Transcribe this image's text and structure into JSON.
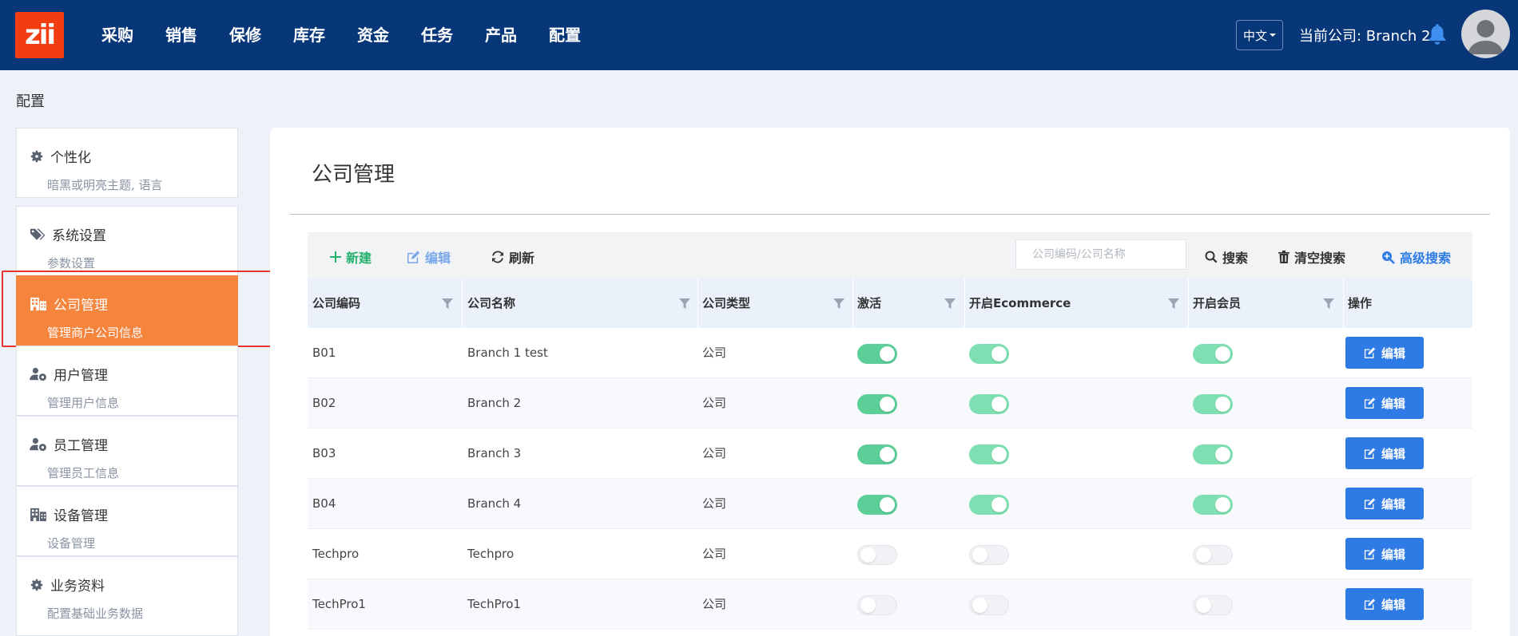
{
  "logo_text": "zii",
  "nav": [
    "采购",
    "销售",
    "保修",
    "库存",
    "资金",
    "任务",
    "产品",
    "配置"
  ],
  "header": {
    "language": "中文",
    "current_company": "当前公司: Branch 2"
  },
  "breadcrumb": "配置",
  "sidebar": [
    {
      "title": "个性化",
      "sub": "暗黑或明亮主题, 语言",
      "icon": "gear-icon"
    },
    {
      "title": "系统设置",
      "sub": "参数设置",
      "icon": "tags-icon"
    },
    {
      "title": "公司管理",
      "sub": "管理商户公司信息",
      "icon": "building-icon",
      "active": true
    },
    {
      "title": "用户管理",
      "sub": "管理用户信息",
      "icon": "user-gear-icon"
    },
    {
      "title": "员工管理",
      "sub": "管理员工信息",
      "icon": "user-gear-icon"
    },
    {
      "title": "设备管理",
      "sub": "设备管理",
      "icon": "building-icon"
    },
    {
      "title": "业务资料",
      "sub": "配置基础业务数据",
      "icon": "gear-icon"
    }
  ],
  "page": {
    "title": "公司管理"
  },
  "toolbar": {
    "new_label": "新建",
    "edit_label": "编辑",
    "refresh_label": "刷新",
    "search_placeholder": "公司编码/公司名称",
    "search_label": "搜索",
    "clear_label": "清空搜索",
    "advanced_label": "高级搜索"
  },
  "table": {
    "columns": [
      "公司编码",
      "公司名称",
      "公司类型",
      "激活",
      "开启Ecommerce",
      "开启会员",
      "操作"
    ],
    "rows": [
      {
        "code": "B01",
        "name": "Branch 1 test",
        "type": "公司",
        "active": true,
        "ecommerce": true,
        "member": true,
        "action": "编辑"
      },
      {
        "code": "B02",
        "name": "Branch 2",
        "type": "公司",
        "active": true,
        "ecommerce": true,
        "member": true,
        "action": "编辑"
      },
      {
        "code": "B03",
        "name": "Branch 3",
        "type": "公司",
        "active": true,
        "ecommerce": true,
        "member": true,
        "action": "编辑"
      },
      {
        "code": "B04",
        "name": "Branch 4",
        "type": "公司",
        "active": true,
        "ecommerce": true,
        "member": true,
        "action": "编辑"
      },
      {
        "code": "Techpro",
        "name": "Techpro",
        "type": "公司",
        "active": false,
        "ecommerce": false,
        "member": false,
        "action": "编辑"
      },
      {
        "code": "TechPro1",
        "name": "TechPro1",
        "type": "公司",
        "active": false,
        "ecommerce": false,
        "member": false,
        "action": "编辑"
      }
    ]
  },
  "colors": {
    "nav_bg": "#073679",
    "accent_orange": "#f5843c",
    "primary_blue": "#2e7be6",
    "toggle_on": "#7ee0b2",
    "new_green": "#23b26d"
  }
}
